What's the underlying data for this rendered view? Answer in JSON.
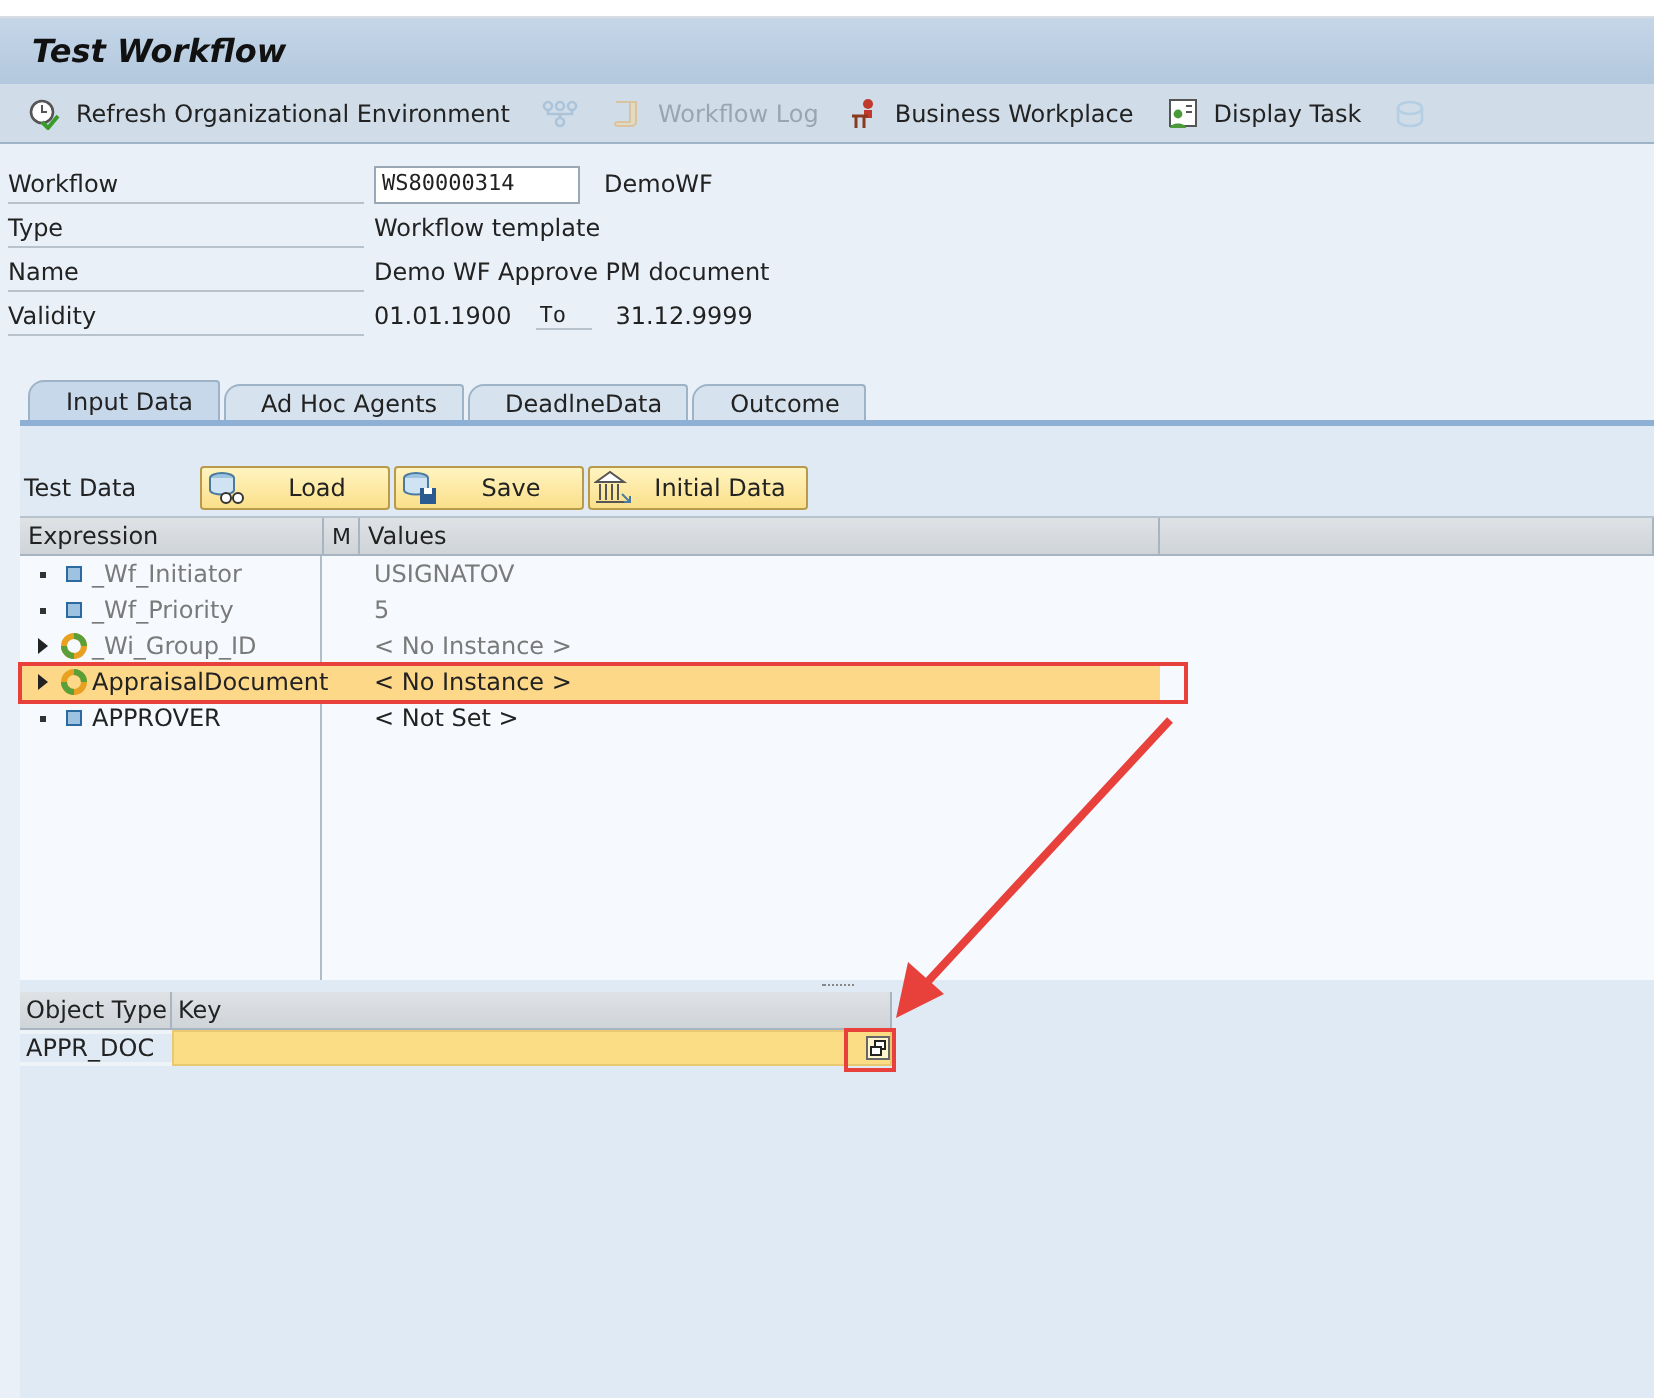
{
  "window": {
    "title": "Test Workflow"
  },
  "toolbar": [
    {
      "label": "Refresh Organizational Environment",
      "kind": "refresh",
      "disabled": false
    },
    {
      "kind": "hierarchy",
      "disabled": true
    },
    {
      "label": "Workflow Log",
      "kind": "log",
      "disabled": true
    },
    {
      "label": "Business Workplace",
      "kind": "workplace",
      "disabled": false
    },
    {
      "label": "Display Task",
      "kind": "task",
      "disabled": false
    },
    {
      "kind": "db",
      "disabled": true
    }
  ],
  "header": {
    "workflow_label": "Workflow",
    "workflow_value": "WS80000314",
    "workflow_name": "DemoWF",
    "type_label": "Type",
    "type_value": "Workflow template",
    "name_label": "Name",
    "name_value": "Demo WF Approve PM document",
    "validity_label": "Validity",
    "valid_from": "01.01.1900",
    "to_label": "To",
    "valid_to": "31.12.9999"
  },
  "tabs": [
    {
      "label": "Input Data",
      "selected": true
    },
    {
      "label": "Ad Hoc Agents",
      "selected": false
    },
    {
      "label": "DeadlneData",
      "selected": false
    },
    {
      "label": "Outcome",
      "selected": false
    }
  ],
  "test_data": {
    "label": "Test Data",
    "buttons": [
      {
        "label": "Load",
        "kind": "load"
      },
      {
        "label": "Save",
        "kind": "save"
      },
      {
        "label": "Initial Data",
        "kind": "initial"
      }
    ]
  },
  "tree": {
    "columns": [
      "Expression",
      "M",
      "Values"
    ],
    "rows": [
      {
        "kind": "element",
        "expression": "_Wf_Initiator",
        "value": "USIGNATOV",
        "disabled": true,
        "selected": false,
        "expandable": false
      },
      {
        "kind": "element",
        "expression": "_Wf_Priority",
        "value": "5",
        "disabled": true,
        "selected": false,
        "expandable": false
      },
      {
        "kind": "object",
        "expression": "_Wi_Group_ID",
        "value": "< No Instance >",
        "disabled": true,
        "selected": false,
        "expandable": true
      },
      {
        "kind": "object",
        "expression": "AppraisalDocument",
        "value": "< No Instance >",
        "disabled": false,
        "selected": true,
        "expandable": true
      },
      {
        "kind": "element",
        "expression": "APPROVER",
        "value": "< Not Set >",
        "disabled": false,
        "selected": false,
        "expandable": false
      }
    ]
  },
  "object_table": {
    "columns": [
      "Object Type",
      "Key"
    ],
    "rows": [
      {
        "object_type": "APPR_DOC"
      }
    ]
  }
}
